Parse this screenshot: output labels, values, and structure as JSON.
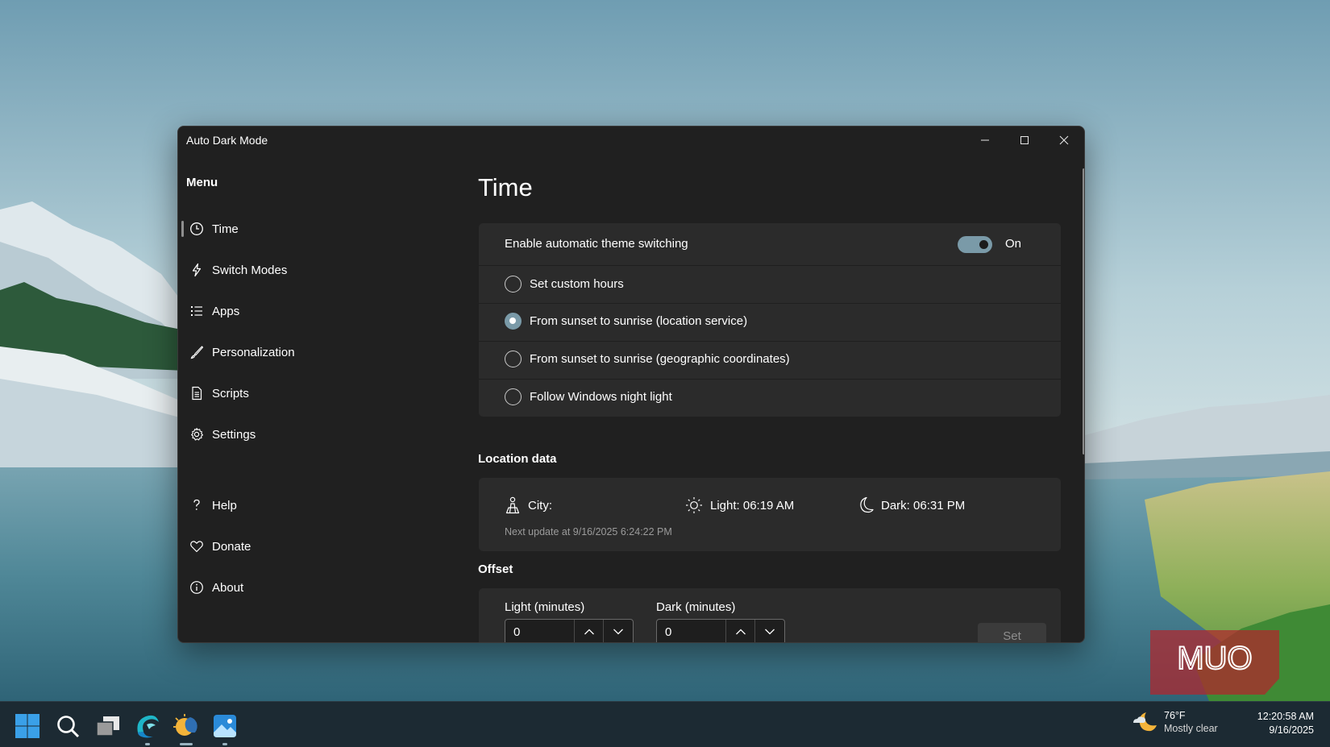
{
  "window": {
    "title": "Auto Dark Mode",
    "controls": {
      "minimize_icon": "minimize-icon",
      "maximize_icon": "maximize-icon",
      "close_icon": "close-icon"
    }
  },
  "sidebar": {
    "menu_title": "Menu",
    "items": [
      {
        "label": "Time",
        "icon": "clock-icon",
        "active": true
      },
      {
        "label": "Switch Modes",
        "icon": "lightning-icon"
      },
      {
        "label": "Apps",
        "icon": "list-icon"
      },
      {
        "label": "Personalization",
        "icon": "brush-icon"
      },
      {
        "label": "Scripts",
        "icon": "document-icon"
      },
      {
        "label": "Settings",
        "icon": "gear-icon"
      }
    ],
    "footer_items": [
      {
        "label": "Help",
        "icon": "question-icon"
      },
      {
        "label": "Donate",
        "icon": "heart-icon"
      },
      {
        "label": "About",
        "icon": "info-icon"
      }
    ]
  },
  "page": {
    "title": "Time",
    "switching": {
      "label": "Enable automatic theme switching",
      "toggle_state": "On",
      "options": [
        {
          "label": "Set custom hours",
          "checked": false
        },
        {
          "label": "From sunset to sunrise (location service)",
          "checked": true
        },
        {
          "label": "From sunset to sunrise (geographic coordinates)",
          "checked": false
        },
        {
          "label": "Follow Windows night light",
          "checked": false
        }
      ]
    },
    "location": {
      "section_title": "Location data",
      "city_label": "City:",
      "light_label": "Light: 06:19 AM",
      "dark_label": "Dark: 06:31 PM",
      "next_update": "Next update at 9/16/2025 6:24:22 PM"
    },
    "offset": {
      "section_title": "Offset",
      "light_label": "Light (minutes)",
      "light_value": "0",
      "dark_label": "Dark (minutes)",
      "dark_value": "0",
      "set_label": "Set"
    }
  },
  "watermark": {
    "text": "MUO"
  },
  "taskbar": {
    "icons": [
      "windows-start-icon",
      "search-icon",
      "task-view-icon",
      "browser-icon",
      "auto-dark-mode-icon",
      "photos-icon"
    ],
    "weather": {
      "temp": "76°F",
      "desc": "Mostly clear"
    },
    "clock": {
      "time": "12:20:58 AM",
      "date": "9/16/2025"
    }
  },
  "colors": {
    "window_bg": "#202020",
    "card_bg": "#2b2b2b",
    "accent": "#7a9aa8",
    "taskbar_bg": "#1c2a33"
  }
}
